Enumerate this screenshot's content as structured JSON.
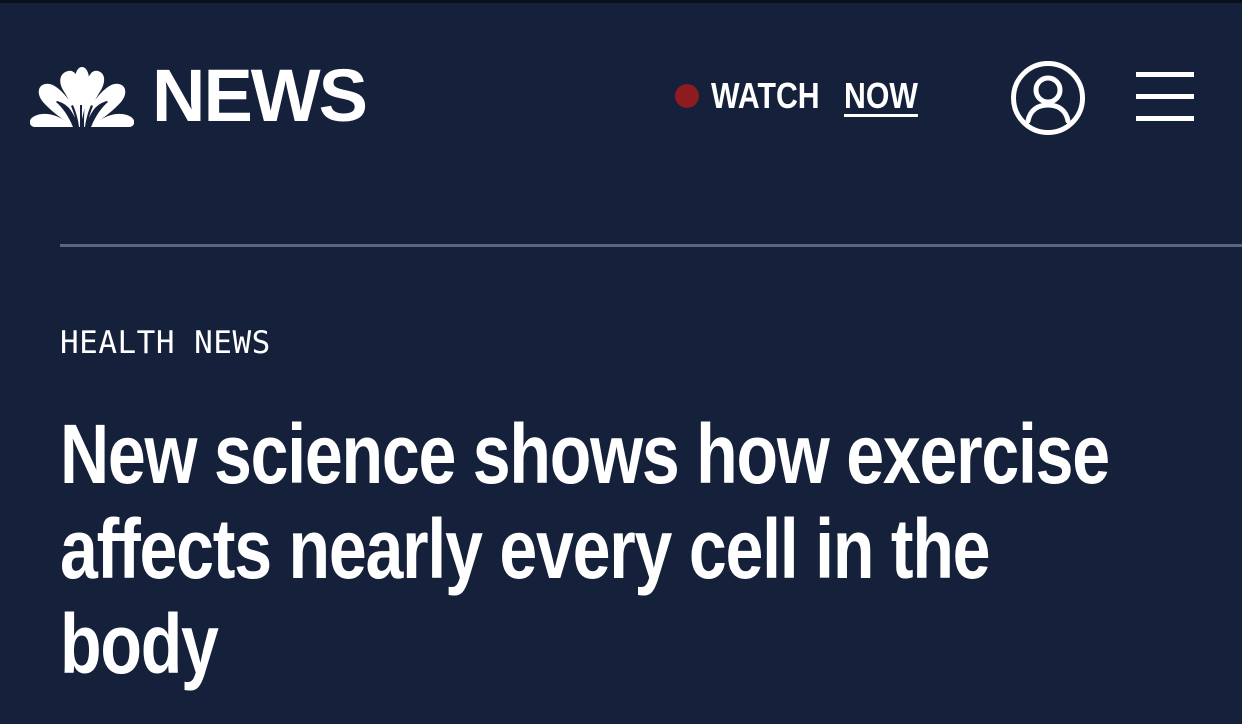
{
  "header": {
    "brand": {
      "logo_icon": "nbc-peacock-icon",
      "wordmark": "NEWS"
    },
    "watch": {
      "label": "WATCH",
      "emphasis": "NOW",
      "live_dot_color": "#8e1b1f"
    },
    "account_icon": "user-circle-icon",
    "menu_icon": "hamburger-menu-icon"
  },
  "article": {
    "category": "HEALTH NEWS",
    "headline_lines": [
      "New science shows how exercise",
      "affects nearly every cell in the",
      "body"
    ]
  },
  "colors": {
    "background": "#15203b",
    "text": "#ffffff",
    "divider": "#5a6584",
    "live_dot": "#8e1b1f"
  }
}
